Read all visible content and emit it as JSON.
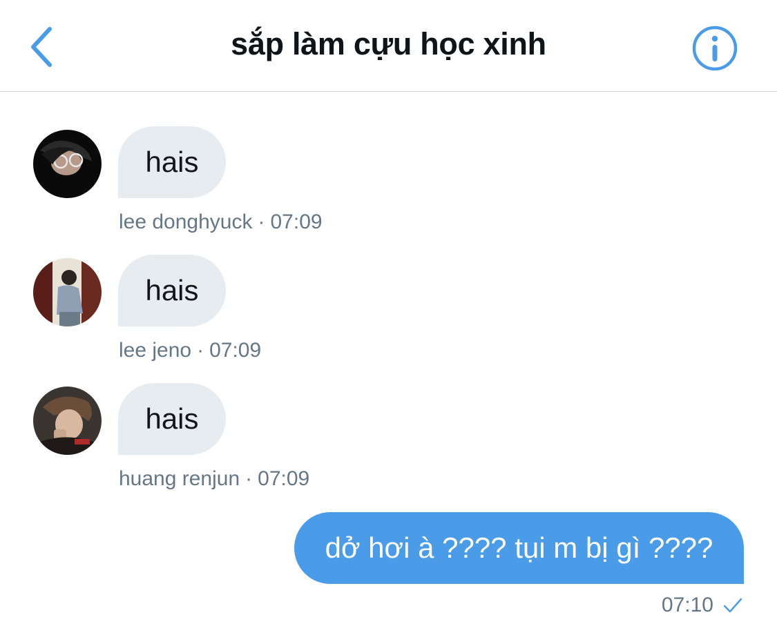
{
  "header": {
    "title": "sắp làm cựu học xinh",
    "back_icon": "chevron-left-icon",
    "info_icon": "info-icon"
  },
  "messages": [
    {
      "sender": "lee donghyuck",
      "text": "hais",
      "time": "07:09",
      "separator": "·"
    },
    {
      "sender": "lee jeno",
      "text": "hais",
      "time": "07:09",
      "separator": "·"
    },
    {
      "sender": "huang renjun",
      "text": "hais",
      "time": "07:09",
      "separator": "·"
    }
  ],
  "outgoing": {
    "text": "dở hơi à ???? tụi m bị gì ????",
    "time": "07:10",
    "status_icon": "checkmark-icon"
  },
  "colors": {
    "accent": "#4a9ce8",
    "bubble_in": "#e6ecf0",
    "meta_text": "#657786",
    "divider": "#d3d6da"
  }
}
